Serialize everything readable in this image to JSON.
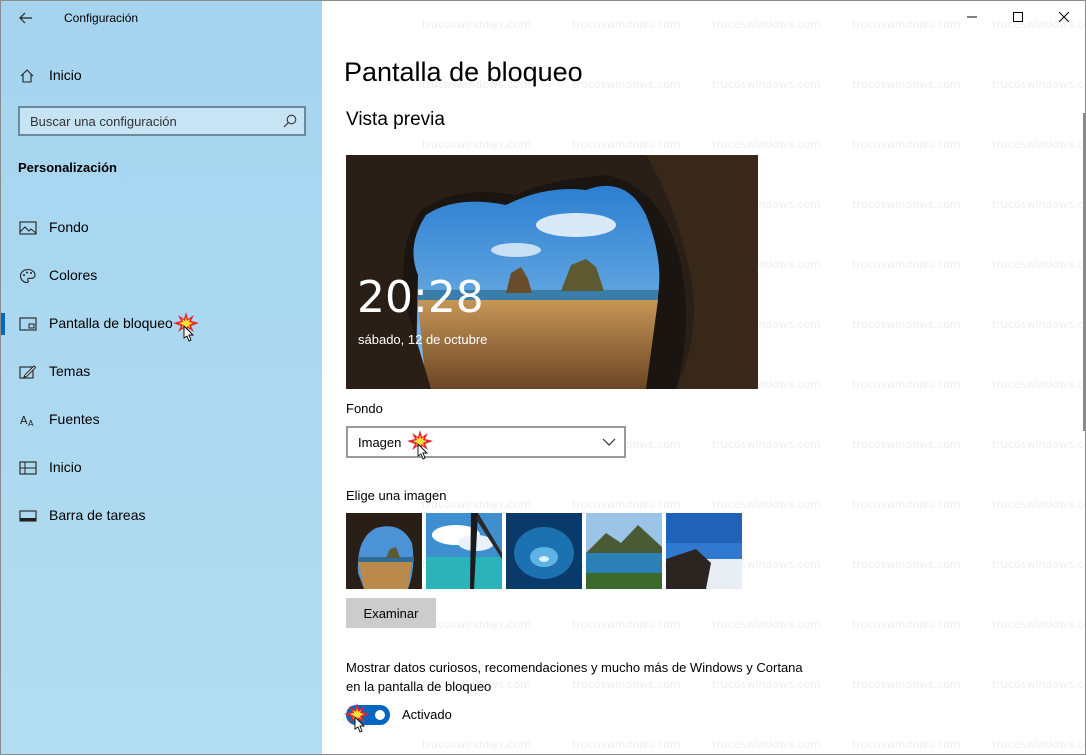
{
  "app": {
    "title": "Configuración",
    "back_icon": "back-arrow-icon"
  },
  "window_controls": {
    "minimize_icon": "minimize-icon",
    "maximize_icon": "maximize-icon",
    "close_icon": "close-icon"
  },
  "sidebar": {
    "home_label": "Inicio",
    "search_placeholder": "Buscar una configuración",
    "section_title": "Personalización",
    "items": [
      {
        "label": "Fondo",
        "icon": "picture-icon",
        "active": false
      },
      {
        "label": "Colores",
        "icon": "palette-icon",
        "active": false
      },
      {
        "label": "Pantalla de bloqueo",
        "icon": "lock-screen-icon",
        "active": true
      },
      {
        "label": "Temas",
        "icon": "themes-icon",
        "active": false
      },
      {
        "label": "Fuentes",
        "icon": "fonts-icon",
        "active": false
      },
      {
        "label": "Inicio",
        "icon": "start-icon",
        "active": false
      },
      {
        "label": "Barra de tareas",
        "icon": "taskbar-icon",
        "active": false
      }
    ]
  },
  "main": {
    "page_title": "Pantalla de bloqueo",
    "preview_title": "Vista previa",
    "preview_time": "20:28",
    "preview_date": "sábado, 12 de octubre",
    "background_label": "Fondo",
    "background_value": "Imagen",
    "choose_image_label": "Elige una imagen",
    "thumbnails": [
      "cave-beach-thumb",
      "window-sea-thumb",
      "ice-cave-thumb",
      "mountain-lake-thumb",
      "coast-horizon-thumb"
    ],
    "browse_button": "Examinar",
    "tips_text": "Mostrar datos curiosos, recomendaciones y mucho más de Windows y Cortana en la pantalla de bloqueo",
    "tips_toggle_state": "Activado",
    "tips_toggle_on": true
  },
  "watermark": "trucoswindows.com",
  "colors": {
    "accent": "#0067c0",
    "sidebar_bg": "#a9d6f0",
    "cursor_burst": "#e8232a"
  }
}
